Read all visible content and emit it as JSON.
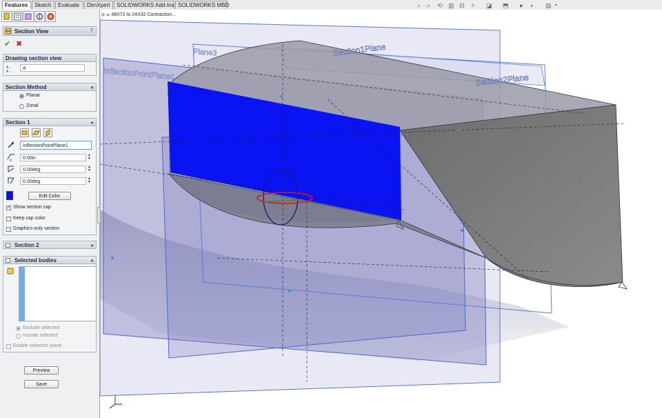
{
  "tabs": [
    {
      "label": "Features",
      "active": true
    },
    {
      "label": "Sketch"
    },
    {
      "label": "Evaluate"
    },
    {
      "label": "DimXpert"
    },
    {
      "label": "SOLIDWORKS Add-Ins"
    },
    {
      "label": "SOLIDWORKS MBD"
    }
  ],
  "panel": {
    "title": "Section View",
    "help": "?",
    "ok": "✔",
    "cancel": "✖",
    "drawing_section_view": {
      "header": "Drawing section view",
      "value": "A"
    },
    "section_method": {
      "header": "Section Method",
      "options": [
        "Planar",
        "Zonal"
      ],
      "selected": "Planar"
    },
    "section1": {
      "header": "Section 1",
      "plane": "InflectionPointPlane1",
      "offset": "0.00in",
      "angle_x": "0.00deg",
      "angle_y": "0.00deg",
      "edit_color": "Edit Color",
      "cap_color": "#0a10f0",
      "show_cap": "Show section cap",
      "keep_cap_color": "Keep cap color",
      "graphics_only": "Graphics-only section"
    },
    "section2": {
      "header": "Section 2"
    },
    "selected_bodies": {
      "header": "Selected bodies",
      "exclude": "Exclude selected",
      "include": "Include selected",
      "enable_plane": "Enable selection plane"
    },
    "preview": "Preview",
    "save": "Save"
  },
  "viewport": {
    "tree_label": "48X72 to 24X32 Contraction...",
    "planes": {
      "inflection": "InflectionPointPlane1",
      "plane3": "Plane3",
      "section1": "Section1Plane",
      "section2": "Section2Plane"
    }
  }
}
